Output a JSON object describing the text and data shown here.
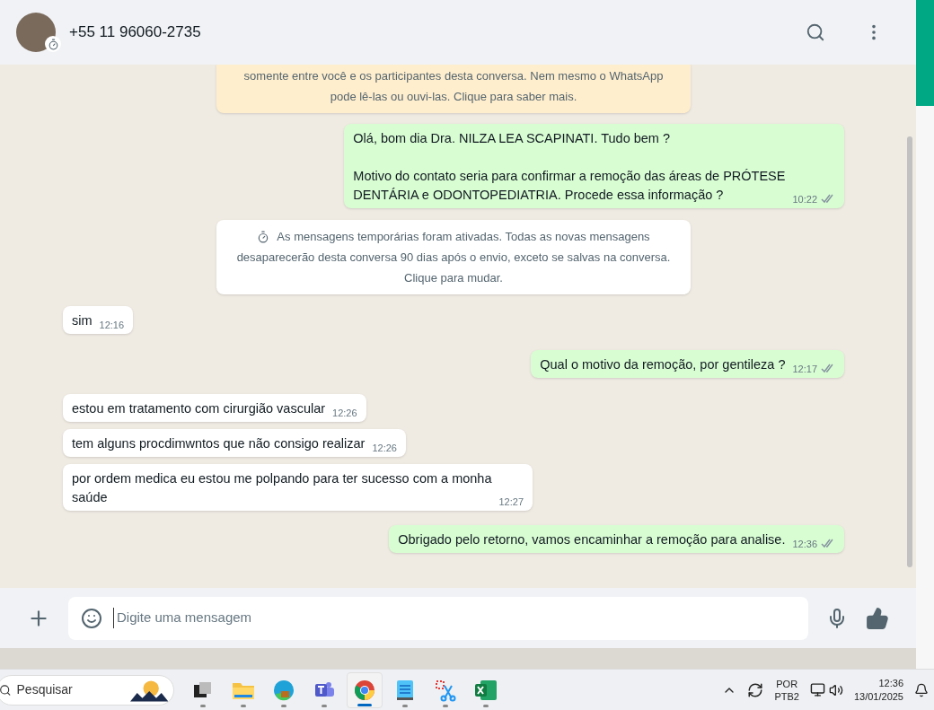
{
  "header": {
    "contact": "+55 11 96060-2735"
  },
  "messages": [
    {
      "kind": "encryption",
      "text": "somente entre você e os participantes desta conversa. Nem mesmo o WhatsApp\npode lê-las ou ouvi-las. Clique para saber mais."
    },
    {
      "kind": "out",
      "text": "Olá, bom dia Dra.  NILZA LEA SCAPINATI. Tudo bem ?\n\nMotivo do contato seria para confirmar a remoção das áreas de  PRÓTESE\nDENTÁRIA e ODONTOPEDIATRIA. Procede essa informação ?",
      "time": "10:22",
      "read": false
    },
    {
      "kind": "notice",
      "text": "As mensagens temporárias foram ativadas. Todas as novas mensagens\ndesaparecerão desta conversa 90 dias após o envio, exceto se salvas na conversa.\nClique para mudar."
    },
    {
      "kind": "in",
      "text": "sim",
      "time": "12:16"
    },
    {
      "kind": "out",
      "text": "Qual o motivo da remoção, por gentileza ?",
      "time": "12:17",
      "read": false
    },
    {
      "kind": "in",
      "text": "estou em tratamento com cirurgião vascular",
      "time": "12:26"
    },
    {
      "kind": "in",
      "text": "tem alguns procdimwntos que não consigo realizar",
      "time": "12:26"
    },
    {
      "kind": "in",
      "text": "por ordem medica eu estou me polpando para ter sucesso com a monha\nsaúde",
      "time": "12:27"
    },
    {
      "kind": "out",
      "text": "Obrigado pelo retorno, vamos encaminhar a remoção para analise.",
      "time": "12:36",
      "read": false
    }
  ],
  "composer": {
    "placeholder": "Digite uma mensagem"
  },
  "taskbar": {
    "search": {
      "placeholder": "Pesquisar"
    },
    "apps": [
      {
        "kind": "taskview",
        "selected": false
      },
      {
        "kind": "files",
        "selected": false
      },
      {
        "kind": "edge",
        "selected": false
      },
      {
        "kind": "teams",
        "selected": false
      },
      {
        "kind": "chrome",
        "selected": true
      },
      {
        "kind": "notepad",
        "selected": false
      },
      {
        "kind": "snip",
        "selected": false
      },
      {
        "kind": "excel",
        "selected": false
      }
    ],
    "language": [
      "POR",
      "PTB2"
    ],
    "time": "12:36",
    "date": "13/01/2025"
  }
}
